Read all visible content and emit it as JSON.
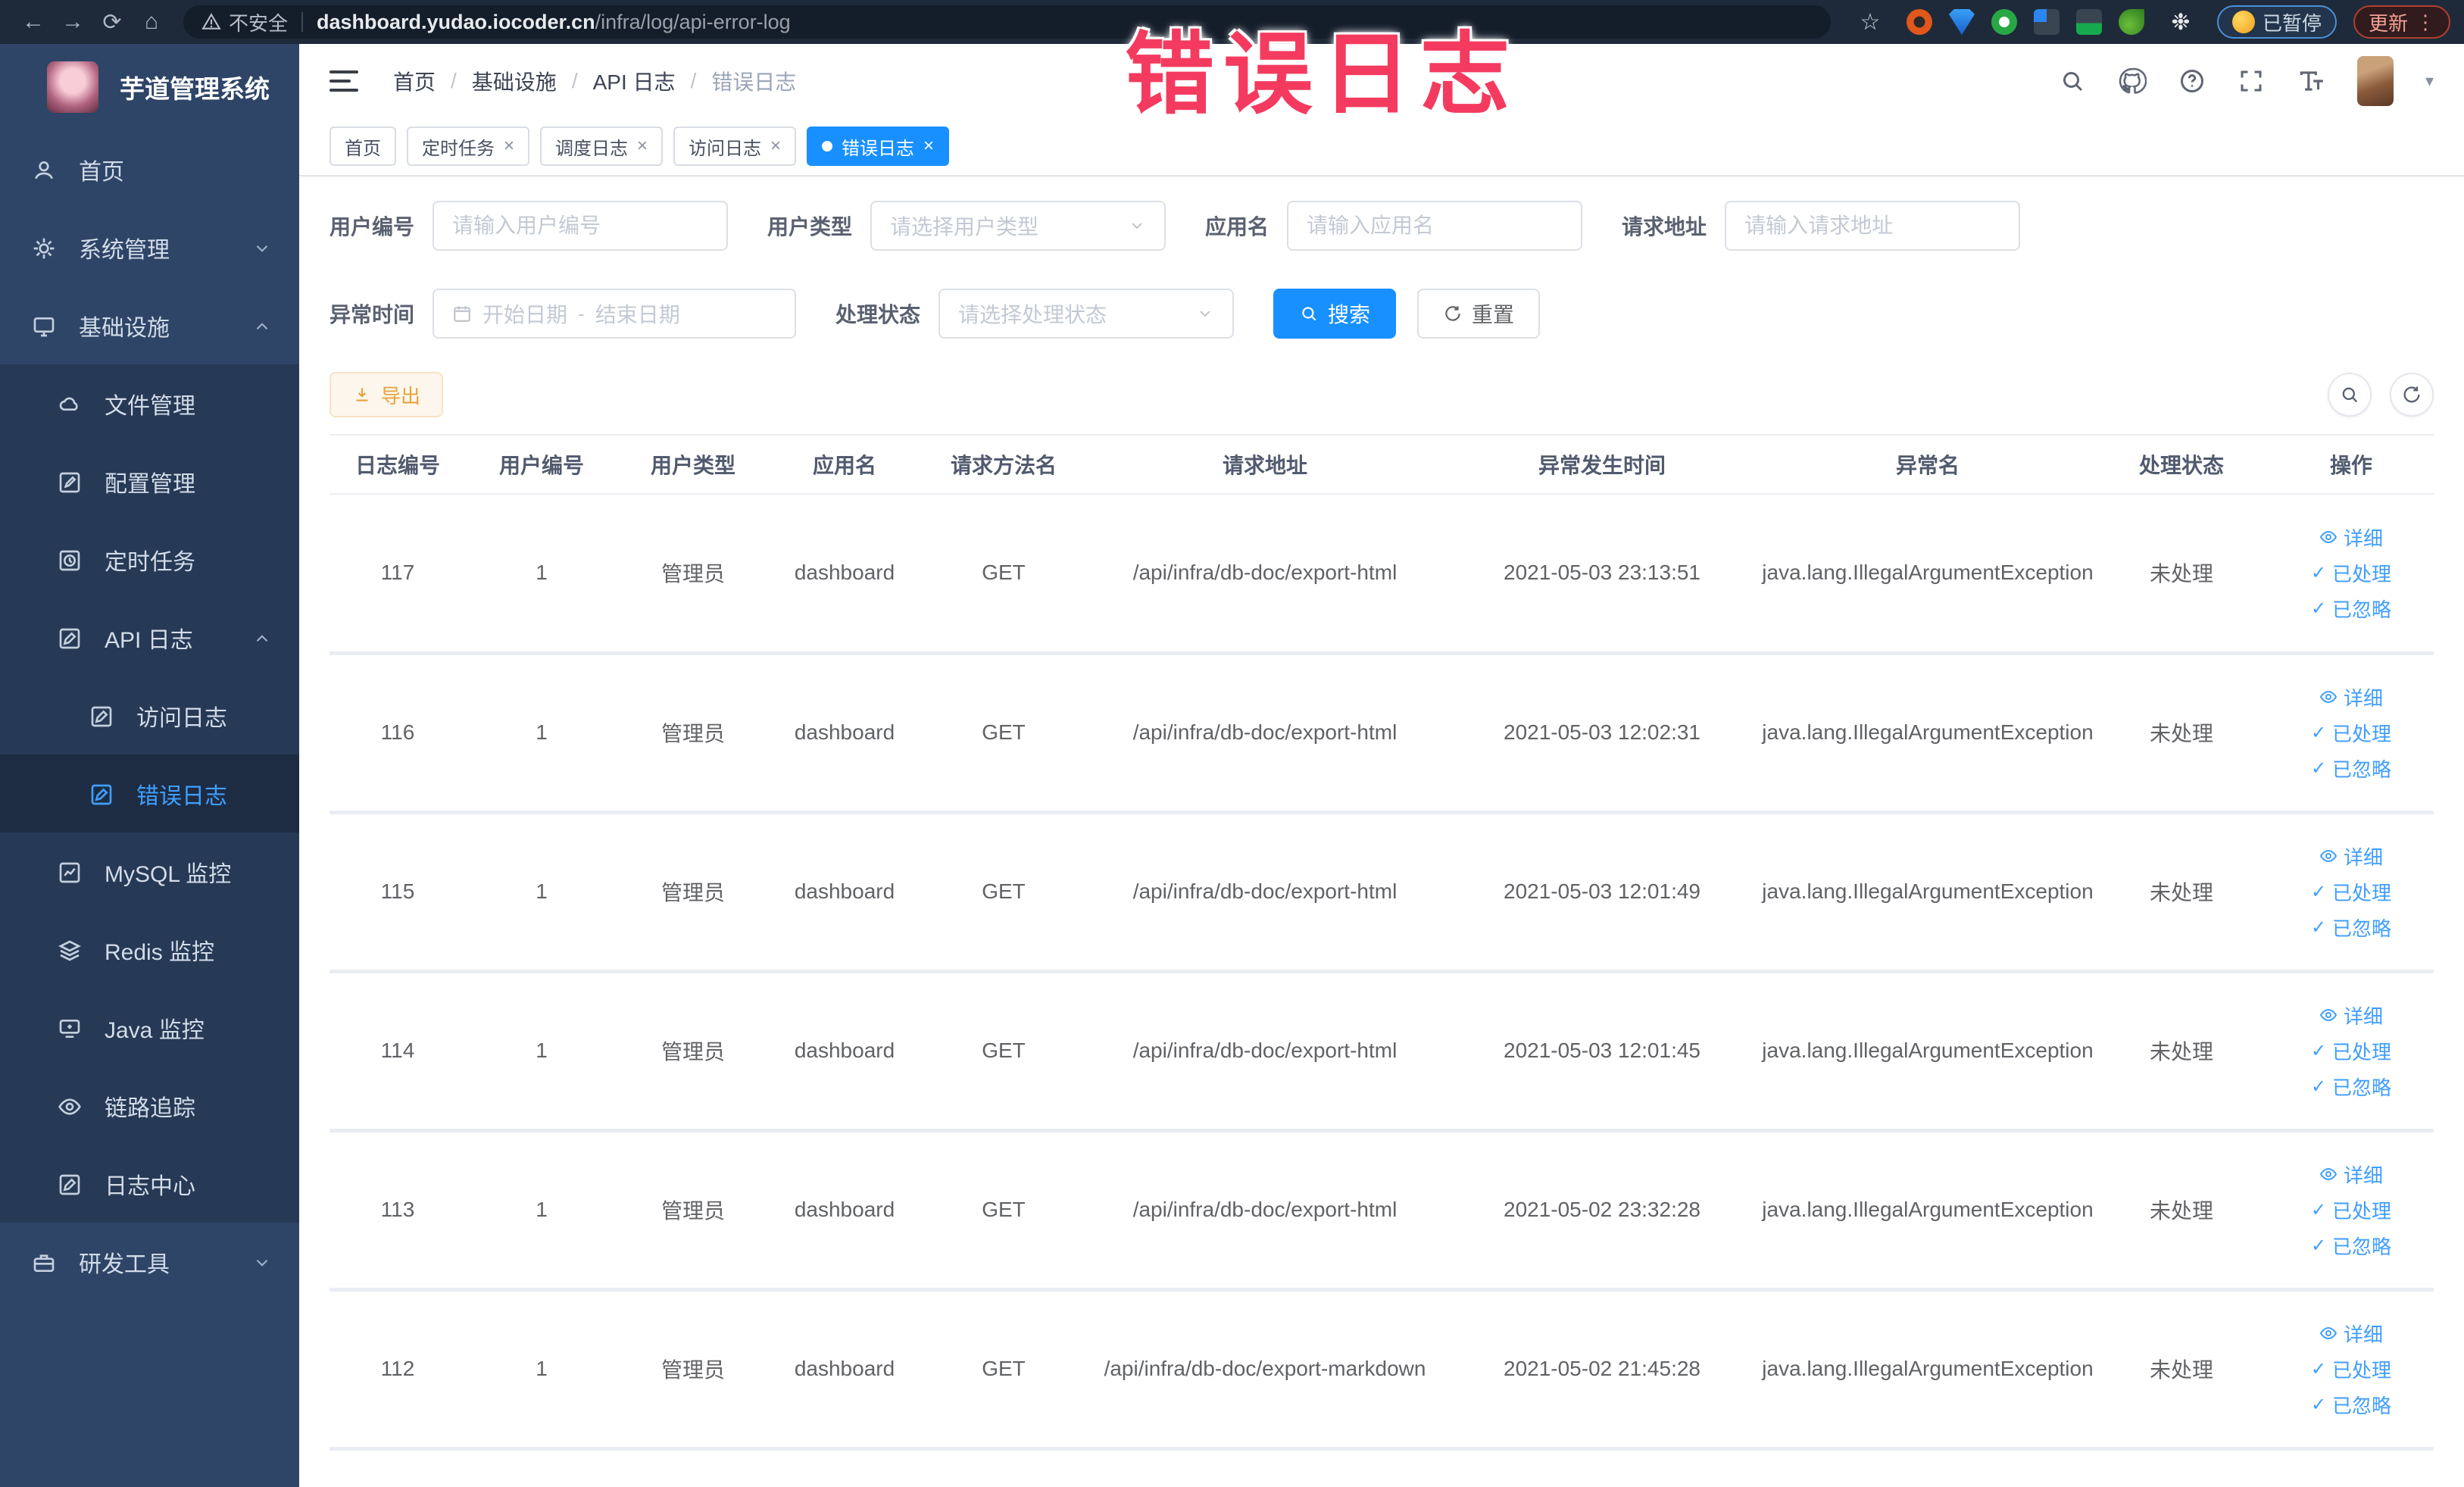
{
  "colors": {
    "accent": "#409eff",
    "tab_active_blue": "#1890ff",
    "warning_orange": "#e6a23c",
    "overlay_pink": "#f43b5f",
    "sidebar_bg": "#2e4567",
    "chrome_bar_bg": "#1e2a39"
  },
  "annotation": {
    "overlay_text": "错误日志"
  },
  "browser": {
    "security_label": "不安全",
    "url_host": "dashboard.yudao.iocoder.cn",
    "url_path": "/infra/log/api-error-log",
    "paused_pill": "已暂停",
    "update_pill": "更新"
  },
  "sidebar": {
    "app_title": "芋道管理系统",
    "items": [
      {
        "label": "首页"
      },
      {
        "label": "系统管理"
      },
      {
        "label": "基础设施"
      },
      {
        "label": "文件管理"
      },
      {
        "label": "配置管理"
      },
      {
        "label": "定时任务"
      },
      {
        "label": "API 日志"
      },
      {
        "label": "访问日志"
      },
      {
        "label": "错误日志"
      },
      {
        "label": "MySQL 监控"
      },
      {
        "label": "Redis 监控"
      },
      {
        "label": "Java 监控"
      },
      {
        "label": "链路追踪"
      },
      {
        "label": "日志中心"
      },
      {
        "label": "研发工具"
      }
    ]
  },
  "header": {
    "breadcrumb": [
      "首页",
      "基础设施",
      "API 日志",
      "错误日志"
    ]
  },
  "tabs": [
    {
      "label": "首页"
    },
    {
      "label": "定时任务"
    },
    {
      "label": "调度日志"
    },
    {
      "label": "访问日志"
    },
    {
      "label": "错误日志"
    }
  ],
  "filters": {
    "user_id": {
      "label": "用户编号",
      "placeholder": "请输入用户编号"
    },
    "user_type": {
      "label": "用户类型",
      "placeholder": "请选择用户类型"
    },
    "app_name": {
      "label": "应用名",
      "placeholder": "请输入应用名"
    },
    "request_url": {
      "label": "请求地址",
      "placeholder": "请输入请求地址"
    },
    "exception_time": {
      "label": "异常时间",
      "start_placeholder": "开始日期",
      "separator": "-",
      "end_placeholder": "结束日期"
    },
    "process_status": {
      "label": "处理状态",
      "placeholder": "请选择处理状态"
    },
    "search_button": "搜索",
    "reset_button": "重置"
  },
  "toolbar": {
    "export_button": "导出"
  },
  "table": {
    "columns": [
      "日志编号",
      "用户编号",
      "用户类型",
      "应用名",
      "请求方法名",
      "请求地址",
      "异常发生时间",
      "异常名",
      "处理状态",
      "操作"
    ],
    "actions": [
      "详细",
      "已处理",
      "已忽略"
    ],
    "rows": [
      {
        "id": "117",
        "user_id": "1",
        "user_type": "管理员",
        "app": "dashboard",
        "method": "GET",
        "url": "/api/infra/db-doc/export-html",
        "time": "2021-05-03 23:13:51",
        "exception": "java.lang.IllegalArgumentException",
        "status": "未处理"
      },
      {
        "id": "116",
        "user_id": "1",
        "user_type": "管理员",
        "app": "dashboard",
        "method": "GET",
        "url": "/api/infra/db-doc/export-html",
        "time": "2021-05-03 12:02:31",
        "exception": "java.lang.IllegalArgumentException",
        "status": "未处理"
      },
      {
        "id": "115",
        "user_id": "1",
        "user_type": "管理员",
        "app": "dashboard",
        "method": "GET",
        "url": "/api/infra/db-doc/export-html",
        "time": "2021-05-03 12:01:49",
        "exception": "java.lang.IllegalArgumentException",
        "status": "未处理"
      },
      {
        "id": "114",
        "user_id": "1",
        "user_type": "管理员",
        "app": "dashboard",
        "method": "GET",
        "url": "/api/infra/db-doc/export-html",
        "time": "2021-05-03 12:01:45",
        "exception": "java.lang.IllegalArgumentException",
        "status": "未处理"
      },
      {
        "id": "113",
        "user_id": "1",
        "user_type": "管理员",
        "app": "dashboard",
        "method": "GET",
        "url": "/api/infra/db-doc/export-html",
        "time": "2021-05-02 23:32:28",
        "exception": "java.lang.IllegalArgumentException",
        "status": "未处理"
      },
      {
        "id": "112",
        "user_id": "1",
        "user_type": "管理员",
        "app": "dashboard",
        "method": "GET",
        "url": "/api/infra/db-doc/export-markdown",
        "time": "2021-05-02 21:45:28",
        "exception": "java.lang.IllegalArgumentException",
        "status": "未处理"
      }
    ]
  }
}
